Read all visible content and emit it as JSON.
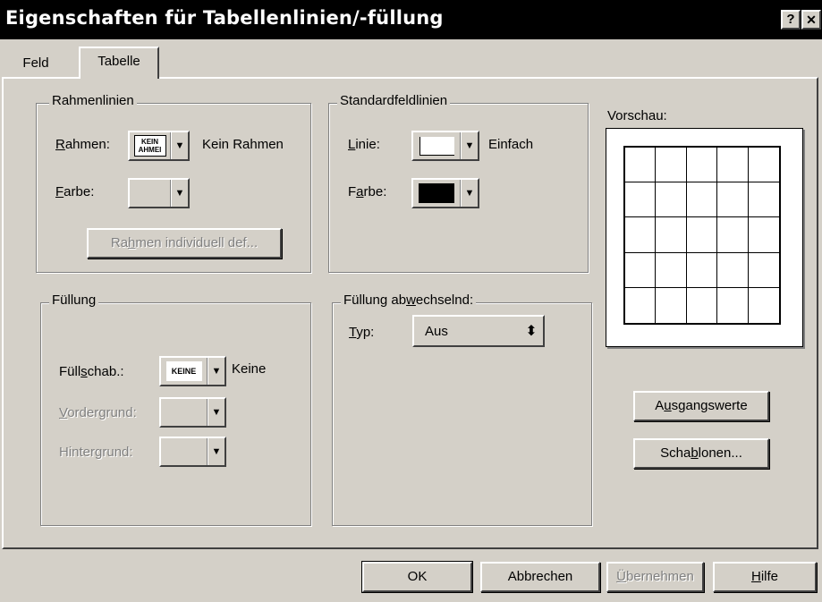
{
  "window": {
    "title": "Eigenschaften für Tabellenlinien/-füllung",
    "help_btn": "?",
    "close_btn": "✕"
  },
  "tabs": [
    {
      "label": "Feld"
    },
    {
      "label": "Tabelle"
    }
  ],
  "rahmenlinien": {
    "legend": "Rahmenlinien",
    "rahmen_label_u": "R",
    "rahmen_label_rest": "ahmen:",
    "rahmen_combo_text_1": "KEIN",
    "rahmen_combo_text_2": "AHMEI",
    "rahmen_value": "Kein Rahmen",
    "farbe_label_u": "F",
    "farbe_label_rest": "arbe:",
    "custom_button_pre": "Ra",
    "custom_button_u": "h",
    "custom_button_post": "men individuell def..."
  },
  "standardfeldlinien": {
    "legend": "Standardfeldlinien",
    "linie_label_u": "L",
    "linie_label_rest": "inie:",
    "linie_value": "Einfach",
    "farbe_label_pre": "F",
    "farbe_label_u": "a",
    "farbe_label_post": "rbe:",
    "farbe_color": "#000000"
  },
  "fuellung": {
    "legend": "Füllung",
    "schab_label_pre": "Füll",
    "schab_label_u": "s",
    "schab_label_post": "chab.:",
    "schab_combo_text": "KEINE",
    "schab_value": "Keine",
    "vordergrund_u": "V",
    "vordergrund_rest": "ordergrund:",
    "hintergrund_pre": "Hinter",
    "hintergrund_u": "g",
    "hintergrund_post": "rund:"
  },
  "fuellung_abwechselnd": {
    "legend_pre": "Füllung ab",
    "legend_u": "w",
    "legend_post": "echselnd:",
    "typ_label_u": "T",
    "typ_label_rest": "yp:",
    "typ_value": "Aus",
    "spinner_icon": "up-down-arrows"
  },
  "preview": {
    "label": "Vorschau:",
    "rows": 5,
    "cols": 5
  },
  "side_buttons": {
    "ausgangswerte_pre": "A",
    "ausgangswerte_u": "u",
    "ausgangswerte_post": "sgangswerte",
    "schablonen_pre": "Scha",
    "schablonen_u": "b",
    "schablonen_post": "lonen..."
  },
  "footer": {
    "ok": "OK",
    "cancel": "Abbrechen",
    "apply_u": "Ü",
    "apply_rest": "bernehmen",
    "help_u": "H",
    "help_rest": "ilfe"
  }
}
